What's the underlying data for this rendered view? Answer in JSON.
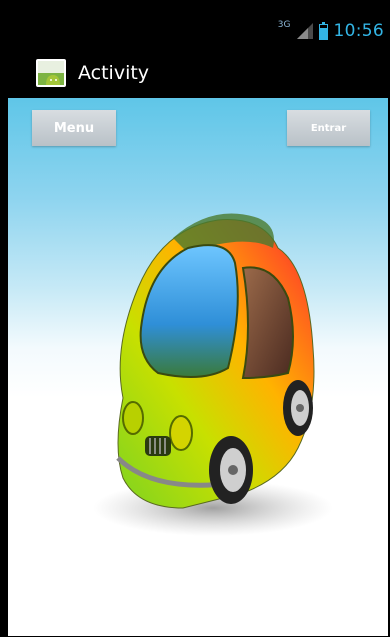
{
  "status_bar": {
    "network_label": "3G",
    "time": "10:56",
    "signal_icon": "signal-icon",
    "battery_icon": "battery-icon",
    "accent_color": "#33b5e5"
  },
  "action_bar": {
    "app_icon": "android-app-icon",
    "title": "Activity"
  },
  "content": {
    "menu_button": "Menu",
    "enter_button": "Entrar",
    "image": "colorful-cartoon-car-image"
  }
}
